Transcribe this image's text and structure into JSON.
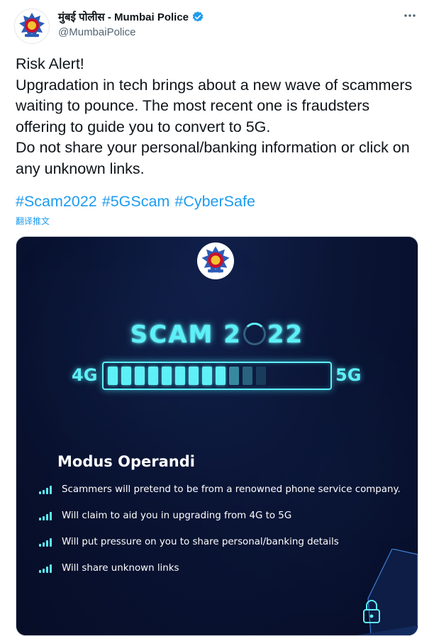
{
  "tweet": {
    "display_name": "मुंबई पोलीस - Mumbai Police",
    "handle": "@MumbaiPolice",
    "more_icon": "more-dots-icon",
    "verified_icon": "verified-badge-icon",
    "text": "Risk Alert!\nUpgradation in tech brings about a new wave of scammers waiting to pounce. The most recent one is fraudsters offering to guide you to convert to 5G.\nDo not share your personal/banking information or click on any unknown links.",
    "hashtags": [
      "#Scam2022",
      "#5GScam",
      "#CyberSafe"
    ],
    "translate_label": "翻译推文",
    "colors": {
      "link": "#1d9bf0",
      "text": "#0f1419",
      "muted": "#536471"
    }
  },
  "media": {
    "title_part1": "SCAM 2",
    "title_part2": "22",
    "label_left": "4G",
    "label_right": "5G",
    "progress_fraction": 0.75,
    "section_title": "Modus Operandi",
    "bullets": [
      "Scammers will pretend to be from a renowned phone service company.",
      "Will claim to aid you in upgrading from 4G to 5G",
      "Will put pressure on you to share personal/banking details",
      "Will share unknown links"
    ],
    "colors": {
      "neon": "#5ef0f7",
      "background": "#0a1434"
    }
  }
}
